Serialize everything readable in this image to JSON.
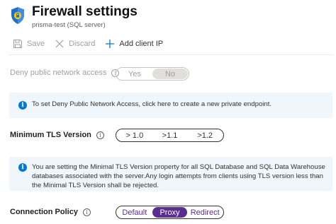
{
  "header": {
    "title": "Firewall settings",
    "subtitle": "prisma-test (SQL server)",
    "icon": "firewall-shield-icon"
  },
  "toolbar": {
    "save_label": "Save",
    "discard_label": "Discard",
    "add_client_ip_label": "Add client IP"
  },
  "deny_public": {
    "label": "Deny public network access",
    "options": [
      "Yes",
      "No"
    ],
    "selected": "No",
    "disabled": true
  },
  "private_endpoint_banner": {
    "text": "To set Deny Public Network Access, click here to create a new private endpoint."
  },
  "min_tls": {
    "label": "Minimum TLS Version",
    "options": [
      "> 1.0",
      ">1.1",
      ">1.2"
    ]
  },
  "tls_banner": {
    "text": "You are setting the Minimal TLS Version property for all SQL Database and SQL Data Warehouse databases associated with the server.Any login attempts from clients using TLS version less than the Minimal TLS Version shall be rejected."
  },
  "connection_policy": {
    "label": "Connection Policy",
    "options": [
      "Default",
      "Proxy",
      "Redirect"
    ],
    "selected": "Proxy"
  },
  "colors": {
    "accent_purple": "#5c2d91",
    "info_blue": "#0078d4",
    "banner_bg": "#eff6fc"
  }
}
